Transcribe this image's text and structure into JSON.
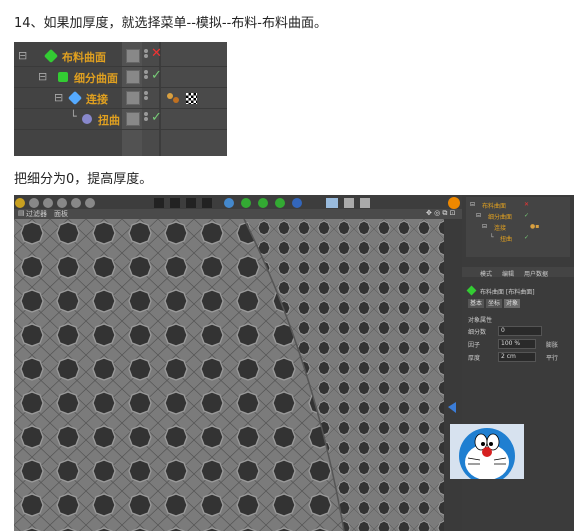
{
  "step_text": "14、如果加厚度，就选择菜单--模拟--布料-布料曲面。",
  "caption_text": "把细分为0，提高厚度。",
  "object_manager": {
    "rows": [
      {
        "label": "布料曲面",
        "icon": "cloth-surface-icon",
        "status": "x"
      },
      {
        "label": "细分曲面",
        "icon": "subdivision-icon",
        "status": "check"
      },
      {
        "label": "连接",
        "icon": "connect-icon",
        "status": "dots",
        "tag_icons": [
          "material-balls-icon",
          "checker-tag-icon"
        ]
      },
      {
        "label": "扭曲",
        "icon": "twist-icon",
        "status": "check"
      }
    ]
  },
  "screenshot": {
    "menu": [
      "过滤器",
      "面板"
    ],
    "right_panel": {
      "om_rows": [
        "布料曲面",
        "细分曲面",
        "连接",
        "扭曲"
      ],
      "attr_tabs": [
        "模式",
        "编辑",
        "用户数据"
      ],
      "object_title": "布料曲面 [布料曲面]",
      "subtabs": [
        "基本",
        "坐标",
        "对象"
      ],
      "section": "对象属性",
      "fields": [
        {
          "label": "细分数",
          "value": "0"
        },
        {
          "label": "因子",
          "value": "100 %",
          "extra": "膨胀"
        },
        {
          "label": "厚度",
          "value": "2 cm",
          "extra": "平行"
        }
      ]
    }
  }
}
